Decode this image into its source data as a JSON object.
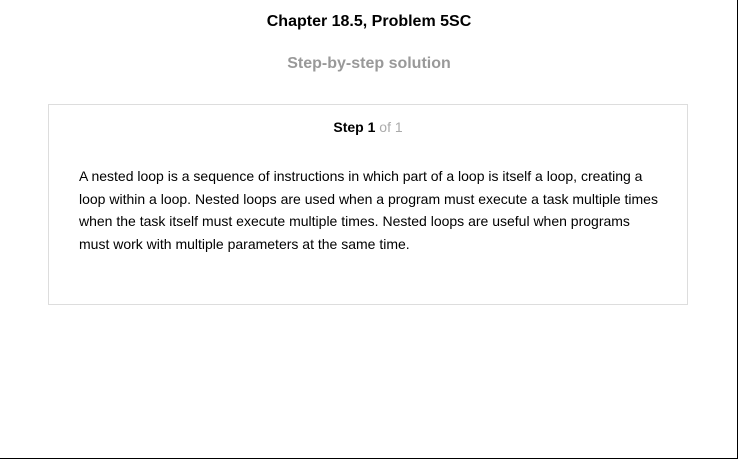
{
  "header": {
    "title": "Chapter 18.5, Problem 5SC",
    "subtitle": "Step-by-step solution"
  },
  "step": {
    "word": "Step",
    "number": "1",
    "of_total": "of 1",
    "content": "A nested loop is a sequence of instructions in which part of a loop is itself a loop, creating a loop within a loop. Nested loops are used when a program must execute a task multiple times when the task itself must execute multiple times. Nested loops are useful when programs must work with multiple parameters at the same time."
  }
}
